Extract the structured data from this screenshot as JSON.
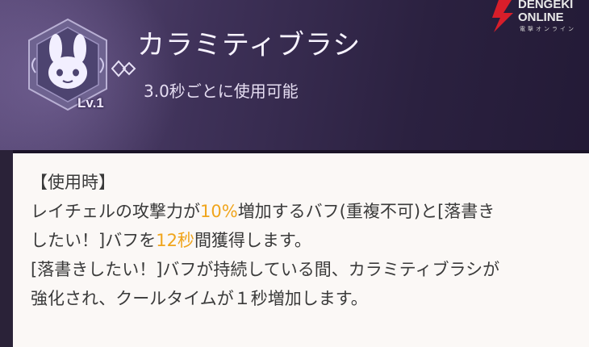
{
  "skill": {
    "name": "カラミティブラシ",
    "cooldown_text": "3.0秒ごとに使用可能",
    "level": "Lv.1",
    "icon": "rabbit-mask-icon"
  },
  "logo": {
    "line1": "DENGEKI",
    "line2": "ONLINE",
    "line3": "電撃オンライン"
  },
  "description": {
    "heading": "【使用時】",
    "l1_a": "レイチェルの攻撃力が",
    "l1_hl": "10%",
    "l1_b": "増加するバフ(重複不可)と[落書き",
    "l2_a": "したい！]バフを",
    "l2_hl": "12秒",
    "l2_b": "間獲得します。",
    "l3": "[落書きしたい！]バフが持続している間、カラミティブラシが",
    "l4": "強化され、クールタイムが１秒増加します。"
  },
  "colors": {
    "highlight": "#f0a51c",
    "logo_red": "#d81e2a",
    "header_bg": "#2b2140"
  }
}
